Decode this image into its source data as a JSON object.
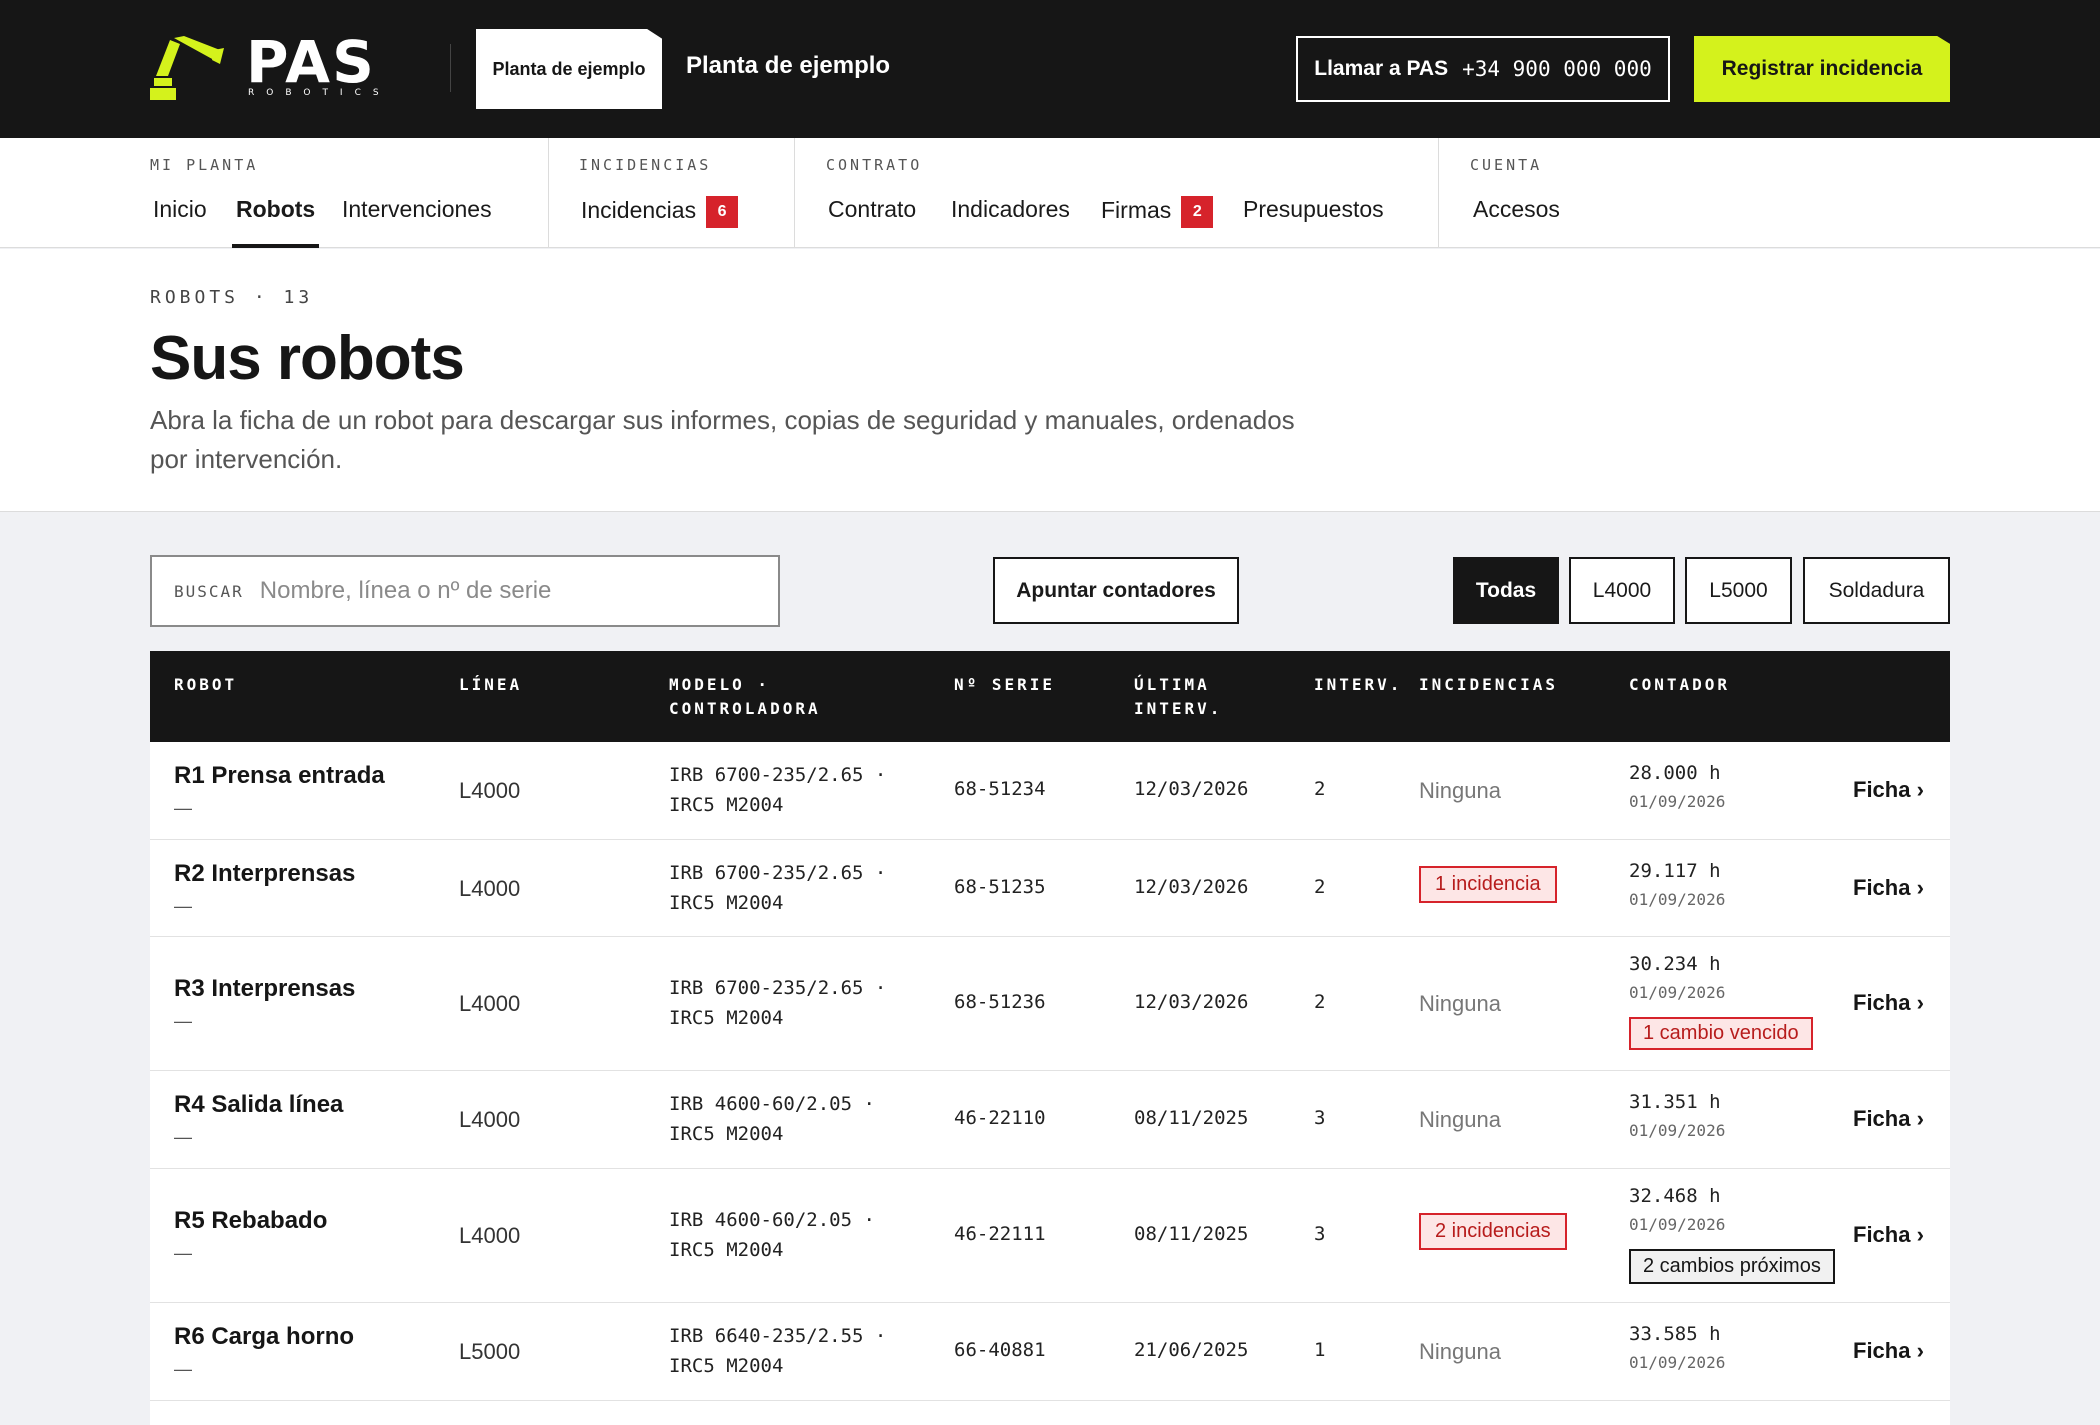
{
  "header": {
    "logo_text": "PAS",
    "logo_sub": "ROBOTICS",
    "plant_chip": "Planta de ejemplo",
    "plant_title": "Planta de ejemplo",
    "call_label": "Llamar a PAS",
    "call_number": "+34 900 000 000",
    "register_label": "Registrar incidencia",
    "accent_color": "#d4f21c"
  },
  "nav": {
    "groups": [
      {
        "category": "MI PLANTA",
        "items": [
          "Inicio",
          "Robots",
          "Intervenciones"
        ]
      },
      {
        "category": "INCIDENCIAS",
        "items": [
          "Incidencias"
        ],
        "badge": "6"
      },
      {
        "category": "CONTRATO",
        "items": [
          "Contrato",
          "Indicadores",
          "Firmas",
          "Presupuestos"
        ],
        "badge": "2"
      },
      {
        "category": "CUENTA",
        "items": [
          "Accesos"
        ]
      }
    ],
    "active": "Robots"
  },
  "page": {
    "eyebrow": "ROBOTS · 13",
    "title": "Sus robots",
    "description": "Abra la ficha de un robot para descargar sus informes, copias de seguridad y manuales, ordenados por intervención."
  },
  "toolbar": {
    "search_label": "BUSCAR",
    "search_placeholder": "Nombre, línea o nº de serie",
    "counter_button": "Apuntar contadores",
    "filters": [
      "Todas",
      "L4000",
      "L5000",
      "Soldadura"
    ],
    "active_filter": "Todas"
  },
  "table": {
    "columns": {
      "robot": "ROBOT",
      "line": "LÍNEA",
      "model_1": "MODELO ·",
      "model_2": "CONTROLADORA",
      "serial": "Nº SERIE",
      "last_1": "ÚLTIMA",
      "last_2": "INTERV.",
      "interv": "INTERV.",
      "incidents": "INCIDENCIAS",
      "counter": "CONTADOR"
    },
    "rows": [
      {
        "name": "R1 Prensa entrada",
        "sub": "—",
        "line": "L4000",
        "model": "IRB 6700-235/2.65 ·",
        "controller": "IRC5 M2004",
        "serial": "68-51234",
        "last": "12/03/2026",
        "interv": "2",
        "incidents": "Ninguna",
        "counter": "28.000 h",
        "counter_date": "01/09/2026",
        "link": "Ficha ›"
      },
      {
        "name": "R2 Interprensas",
        "sub": "—",
        "line": "L4000",
        "model": "IRB 6700-235/2.65 ·",
        "controller": "IRC5 M2004",
        "serial": "68-51235",
        "last": "12/03/2026",
        "interv": "2",
        "incidents": "1 incidencia",
        "counter": "29.117 h",
        "counter_date": "01/09/2026",
        "link": "Ficha ›"
      },
      {
        "name": "R3 Interprensas",
        "sub": "—",
        "line": "L4000",
        "model": "IRB 6700-235/2.65 ·",
        "controller": "IRC5 M2004",
        "serial": "68-51236",
        "last": "12/03/2026",
        "interv": "2",
        "incidents": "Ninguna",
        "counter": "30.234 h",
        "counter_date": "01/09/2026",
        "counter_tag": "1 cambio vencido",
        "link": "Ficha ›"
      },
      {
        "name": "R4 Salida línea",
        "sub": "—",
        "line": "L4000",
        "model": "IRB 4600-60/2.05 ·",
        "controller": "IRC5 M2004",
        "serial": "46-22110",
        "last": "08/11/2025",
        "interv": "3",
        "incidents": "Ninguna",
        "counter": "31.351 h",
        "counter_date": "01/09/2026",
        "link": "Ficha ›"
      },
      {
        "name": "R5 Rebabado",
        "sub": "—",
        "line": "L4000",
        "model": "IRB 4600-60/2.05 ·",
        "controller": "IRC5 M2004",
        "serial": "46-22111",
        "last": "08/11/2025",
        "interv": "3",
        "incidents": "2 incidencias",
        "counter": "32.468 h",
        "counter_date": "01/09/2026",
        "counter_tag": "2 cambios próximos",
        "link": "Ficha ›"
      },
      {
        "name": "R6 Carga horno",
        "sub": "—",
        "line": "L5000",
        "model": "IRB 6640-235/2.55 ·",
        "controller": "IRC5 M2004",
        "serial": "66-40881",
        "last": "21/06/2025",
        "interv": "1",
        "incidents": "Ninguna",
        "counter": "33.585 h",
        "counter_date": "01/09/2026",
        "link": "Ficha ›"
      }
    ]
  }
}
